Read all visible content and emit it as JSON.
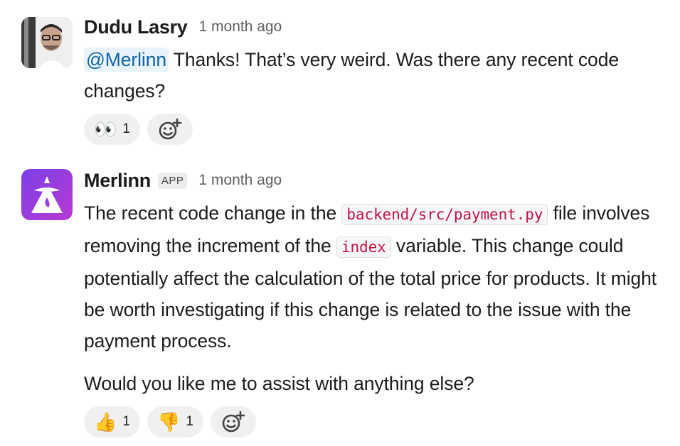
{
  "messages": [
    {
      "author": "Dudu Lasry",
      "time": "1 month ago",
      "mention": "@Merlinn",
      "text": " Thanks! That’s very weird. Was there any recent code changes?",
      "reactions": [
        {
          "emoji": "👀",
          "count": "1",
          "icon": "eyes-icon"
        }
      ],
      "add_reaction_icon": "add-reaction-icon"
    },
    {
      "author": "Merlinn",
      "badge": "APP",
      "time": "1 month ago",
      "paragraph1": {
        "part1": "The recent code change in the ",
        "code1": "backend/src/payment.py",
        "part2": " file involves removing the increment of the ",
        "code2": "index",
        "part3": " variable. This change could potentially affect the calculation of the total price for products. It might be worth investigating if this change is related to the issue with the payment process."
      },
      "paragraph2": "Would you like me to assist with anything else?",
      "reactions": [
        {
          "emoji": "👍",
          "count": "1",
          "icon": "thumbs-up-icon"
        },
        {
          "emoji": "👎",
          "count": "1",
          "icon": "thumbs-down-icon"
        }
      ],
      "add_reaction_icon": "add-reaction-icon"
    }
  ],
  "colors": {
    "merlinn_avatar_start": "#7b3fe4",
    "merlinn_avatar_end": "#b83ad6",
    "code_text": "#c01343",
    "mention_text": "#1264a3"
  }
}
